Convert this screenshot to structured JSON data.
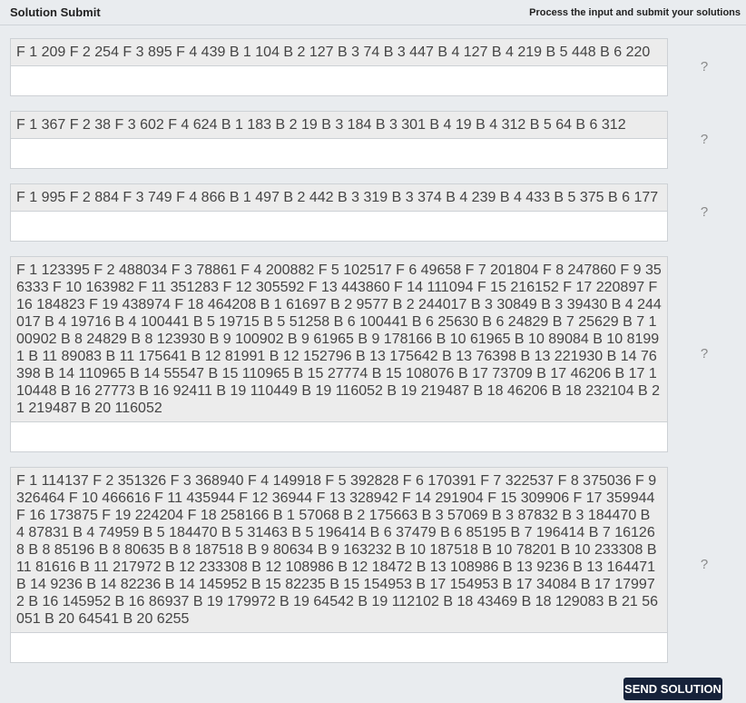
{
  "header": {
    "title": "Solution Submit",
    "subtitle": "Process the input and submit your solutions"
  },
  "problems": [
    {
      "input": "F 1 209 F 2 254 F 3 895 F 4 439 B 1 104 B 2 127 B 3 74 B 3 447 B 4 127 B 4 219 B 5 448 B 6 220",
      "answer": "",
      "help": "?"
    },
    {
      "input": "F 1 367 F 2 38 F 3 602 F 4 624 B 1 183 B 2 19 B 3 184 B 3 301 B 4 19 B 4 312 B 5 64 B 6 312",
      "answer": "",
      "help": "?"
    },
    {
      "input": "F 1 995 F 2 884 F 3 749 F 4 866 B 1 497 B 2 442 B 3 319 B 3 374 B 4 239 B 4 433 B 5 375 B 6 177",
      "answer": "",
      "help": "?"
    },
    {
      "input": "F 1 123395 F 2 488034 F 3 78861 F 4 200882 F 5 102517 F 6 49658 F 7 201804 F 8 247860 F 9 356333 F 10 163982 F 11 351283 F 12 305592 F 13 443860 F 14 111094 F 15 216152 F 17 220897 F 16 184823 F 19 438974 F 18 464208 B 1 61697 B 2 9577 B 2 244017 B 3 30849 B 3 39430 B 4 244017 B 4 19716 B 4 100441 B 5 19715 B 5 51258 B 6 100441 B 6 25630 B 6 24829 B 7 25629 B 7 100902 B 8 24829 B 8 123930 B 9 100902 B 9 61965 B 9 178166 B 10 61965 B 10 89084 B 10 81991 B 11 89083 B 11 175641 B 12 81991 B 12 152796 B 13 175642 B 13 76398 B 13 221930 B 14 76398 B 14 110965 B 14 55547 B 15 110965 B 15 27774 B 15 108076 B 17 73709 B 17 46206 B 17 110448 B 16 27773 B 16 92411 B 19 110449 B 19 116052 B 19 219487 B 18 46206 B 18 232104 B 21 219487 B 20 116052",
      "answer": "",
      "help": "?"
    },
    {
      "input": "F 1 114137 F 2 351326 F 3 368940 F 4 149918 F 5 392828 F 6 170391 F 7 322537 F 8 375036 F 9 326464 F 10 466616 F 11 435944 F 12 36944 F 13 328942 F 14 291904 F 15 309906 F 17 359944 F 16 173875 F 19 224204 F 18 258166 B 1 57068 B 2 175663 B 3 57069 B 3 87832 B 3 184470 B 4 87831 B 4 74959 B 5 184470 B 5 31463 B 5 196414 B 6 37479 B 6 85195 B 7 196414 B 7 161268 B 8 85196 B 8 80635 B 8 187518 B 9 80634 B 9 163232 B 10 187518 B 10 78201 B 10 233308 B 11 81616 B 11 217972 B 12 233308 B 12 108986 B 12 18472 B 13 108986 B 13 9236 B 13 164471 B 14 9236 B 14 82236 B 14 145952 B 15 82235 B 15 154953 B 17 154953 B 17 34084 B 17 179972 B 16 145952 B 16 86937 B 19 179972 B 19 64542 B 19 112102 B 18 43469 B 18 129083 B 21 56051 B 20 64541 B 20 6255",
      "answer": "",
      "help": "?"
    }
  ],
  "send_button": {
    "label": "SEND SOLUTION"
  }
}
